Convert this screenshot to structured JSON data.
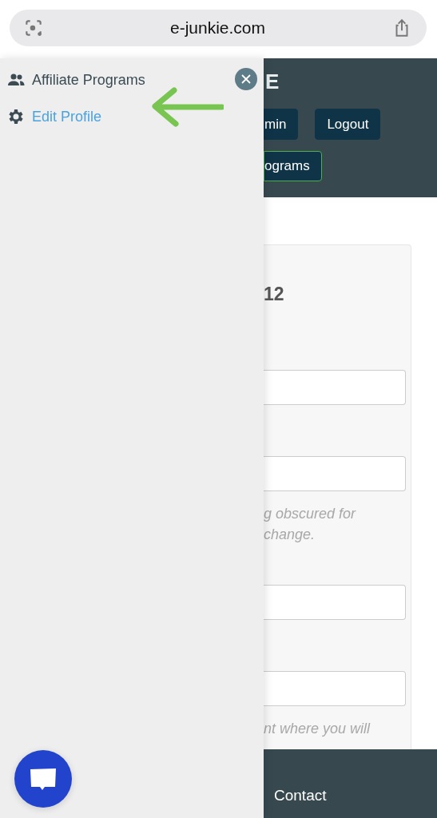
{
  "browser": {
    "url": "e-junkie.com"
  },
  "drawer": {
    "items": [
      {
        "label": "Affiliate Programs",
        "selected": false
      },
      {
        "label": "Edit Profile",
        "selected": true
      }
    ]
  },
  "header": {
    "logo": "E",
    "button_rows": [
      [
        {
          "label": "min",
          "outlined": false
        },
        {
          "label": "Logout",
          "outlined": false
        }
      ],
      [
        {
          "label": "ograms",
          "outlined": true
        }
      ]
    ]
  },
  "form": {
    "heading": "12",
    "items": [
      {
        "kind": "field"
      },
      {
        "kind": "field"
      },
      {
        "kind": "hint",
        "lines": [
          "g obscured for",
          "change."
        ]
      },
      {
        "kind": "field"
      },
      {
        "kind": "field"
      },
      {
        "kind": "hint",
        "lines": [
          "nt where you will"
        ]
      }
    ]
  },
  "footer": {
    "links": [
      "Contact"
    ]
  }
}
